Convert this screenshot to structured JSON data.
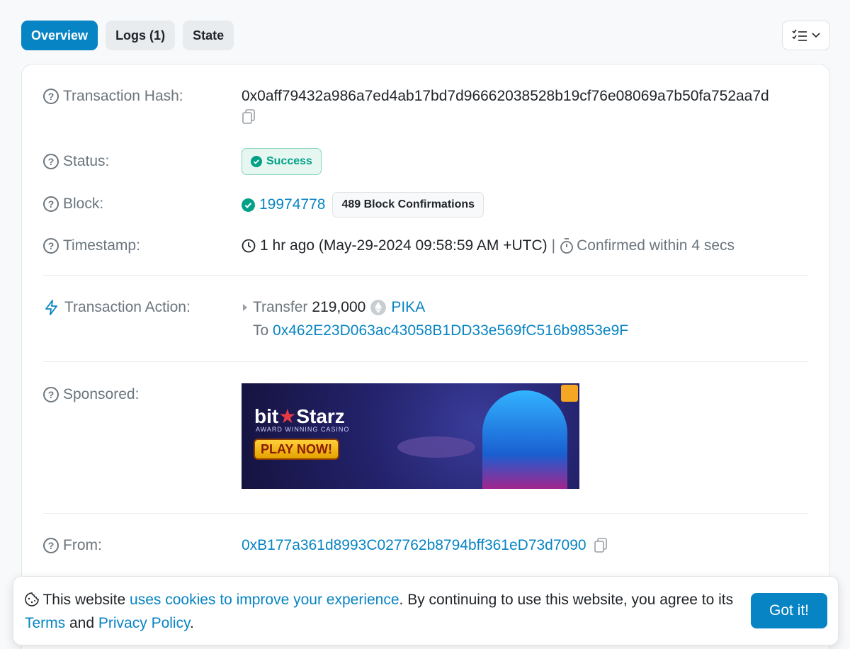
{
  "tabs": [
    {
      "label": "Overview",
      "active": true
    },
    {
      "label": "Logs (1)",
      "active": false
    },
    {
      "label": "State",
      "active": false
    }
  ],
  "details": {
    "tx_hash_label": "Transaction Hash:",
    "tx_hash": "0x0aff79432a986a7ed4ab17bd7d96662038528b19cf76e08069a7b50fa752aa7d",
    "status_label": "Status:",
    "status": "Success",
    "block_label": "Block:",
    "block": "19974778",
    "block_confirmations": "489 Block Confirmations",
    "timestamp_label": "Timestamp:",
    "timestamp": "1 hr ago (May-29-2024 09:58:59 AM +UTC)",
    "separator": "|",
    "confirmed_within": "Confirmed within 4 secs",
    "action_label": "Transaction Action:",
    "action_verb": "Transfer",
    "action_amount": "219,000",
    "action_token": "PIKA",
    "action_to_label": "To",
    "action_to_address": "0x462E23D063ac43058B1DD33e569fC516b9853e9F",
    "sponsored_label": "Sponsored:",
    "from_label": "From:",
    "from_address": "0xB177a361d8993C027762b8794bff361eD73d7090"
  },
  "ad": {
    "brand_left": "bit",
    "brand_right": "Starz",
    "tagline": "AWARD WINNING CASINO",
    "cta": "PLAY NOW!"
  },
  "cookie": {
    "prefix": "This website ",
    "link1": "uses cookies to improve your experience",
    "middle": ". By continuing to use this website, you agree to its ",
    "link2": "Terms",
    "and": " and ",
    "link3": "Privacy Policy",
    "suffix": ".",
    "button": "Got it!"
  },
  "colors": {
    "accent": "#0784c3",
    "success": "#00a186",
    "muted": "#6c757d"
  }
}
